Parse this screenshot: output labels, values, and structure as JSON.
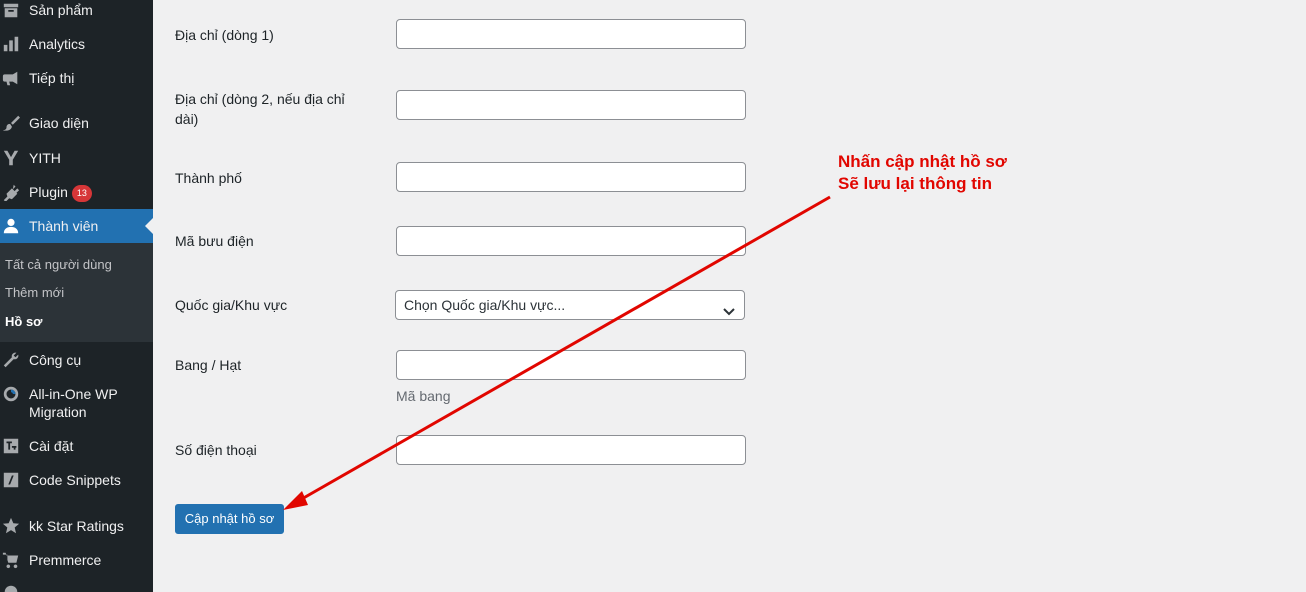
{
  "sidebar": {
    "items": [
      {
        "label": "Sản phẩm",
        "icon": "archive-icon"
      },
      {
        "label": "Analytics",
        "icon": "bar-chart-icon"
      },
      {
        "label": "Tiếp thị",
        "icon": "megaphone-icon"
      },
      {
        "label": "Giao diện",
        "icon": "paintbrush-icon"
      },
      {
        "label": "YITH",
        "icon": "yith-logo-icon"
      },
      {
        "label": "Plugin",
        "icon": "plug-icon",
        "badge": "13"
      },
      {
        "label": "Thành viên",
        "icon": "user-icon",
        "active": true
      },
      {
        "label": "Công cụ",
        "icon": "wrench-icon"
      },
      {
        "label": "All-in-One WP Migration",
        "icon": "migration-icon"
      },
      {
        "label": "Cài đặt",
        "icon": "settings-sliders-icon"
      },
      {
        "label": "Code Snippets",
        "icon": "code-snippets-icon"
      },
      {
        "label": "kk Star Ratings",
        "icon": "star-icon"
      },
      {
        "label": "Premmerce",
        "icon": "cart-icon"
      }
    ],
    "submenu": [
      {
        "label": "Tất cả người dùng"
      },
      {
        "label": "Thêm mới"
      },
      {
        "label": "Hồ sơ",
        "current": true
      }
    ]
  },
  "form": {
    "address1_label": "Địa chỉ (dòng 1)",
    "address1_value": "",
    "address2_label": "Địa chỉ (dòng 2, nếu địa chỉ dài)",
    "address2_value": "",
    "city_label": "Thành phố",
    "city_value": "",
    "postcode_label": "Mã bưu điện",
    "postcode_value": "",
    "country_label": "Quốc gia/Khu vực",
    "country_selected": "Chọn Quốc gia/Khu vực...",
    "state_label": "Bang / Hạt",
    "state_value": "",
    "state_help": "Mã bang",
    "phone_label": "Số điện thoại",
    "phone_value": "",
    "submit_label": "Cập nhật hồ sơ"
  },
  "annotation": {
    "line1": "Nhấn cập nhật hồ sơ",
    "line2": "Sẽ lưu lại thông tin",
    "color": "#e10600"
  },
  "colors": {
    "sidebar_bg": "#1d2327",
    "accent": "#2271b1",
    "badge": "#d63638"
  }
}
